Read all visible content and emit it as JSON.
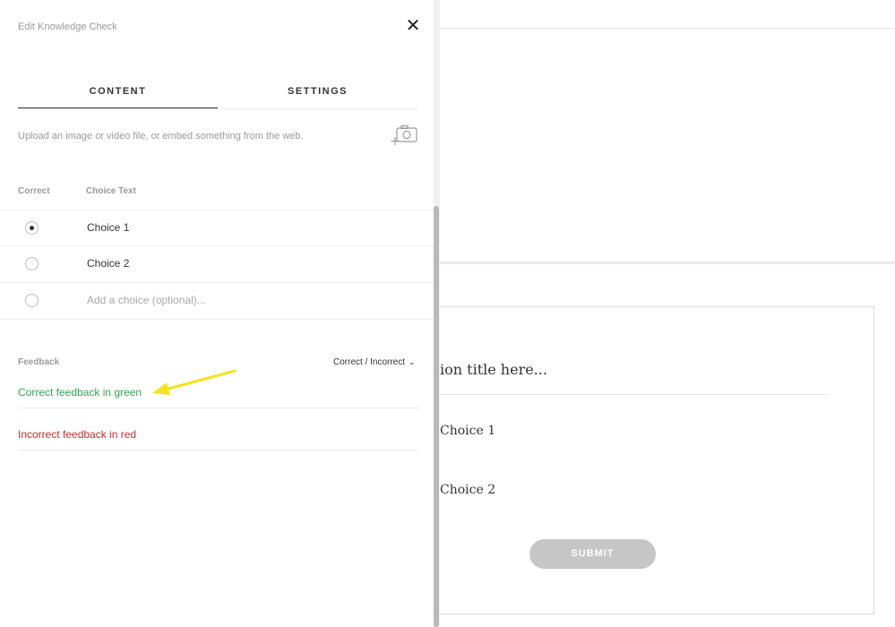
{
  "panel": {
    "title": "Edit Knowledge Check",
    "close_glyph": "✕",
    "tabs": [
      {
        "label": "CONTENT",
        "active": true
      },
      {
        "label": "SETTINGS",
        "active": false
      }
    ],
    "upload_text": "Upload an image or video file, or embed something from the web.",
    "upload_icon": "add-media-camera-icon",
    "columns": {
      "correct": "Correct",
      "choice_text": "Choice Text"
    },
    "choices": [
      {
        "text": "Choice 1",
        "selected": true
      },
      {
        "text": "Choice 2",
        "selected": false
      }
    ],
    "add_choice_placeholder": "Add a choice (optional)...",
    "feedback": {
      "label": "Feedback",
      "mode": "Correct / Incorrect",
      "correct": "Correct feedback in green",
      "incorrect": "Incorrect feedback in red"
    },
    "colors": {
      "correct": "#33a454",
      "incorrect": "#c0302e",
      "annotation_arrow": "#f4e21c"
    }
  },
  "preview": {
    "question_placeholder": "ion title here...",
    "choices": [
      "Choice 1",
      "Choice 2"
    ],
    "submit_label": "SUBMIT"
  }
}
